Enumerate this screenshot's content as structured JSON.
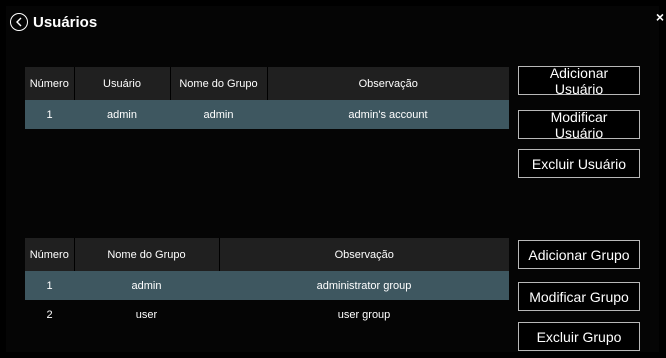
{
  "window": {
    "title": "Usuários"
  },
  "users_table": {
    "columns": [
      "Número",
      "Usuário",
      "Nome do Grupo",
      "Observação"
    ],
    "rows": [
      {
        "numero": "1",
        "usuario": "admin",
        "grupo": "admin",
        "observacao": "admin's account"
      }
    ]
  },
  "user_actions": {
    "add": "Adicionar Usuário",
    "modify": "Modificar Usuário",
    "delete": "Excluir Usuário"
  },
  "groups_table": {
    "columns": [
      "Número",
      "Nome do Grupo",
      "Observação"
    ],
    "rows": [
      {
        "numero": "1",
        "grupo": "admin",
        "observacao": "administrator group"
      },
      {
        "numero": "2",
        "grupo": "user",
        "observacao": "user group"
      }
    ]
  },
  "group_actions": {
    "add": "Adicionar Grupo",
    "modify": "Modificar Grupo",
    "delete": "Excluir Grupo"
  },
  "colors": {
    "background": "#000000",
    "header_cell": "#202020",
    "selected_row": "#3e5760",
    "button_border": "#b8b8b8"
  },
  "icons": {
    "back": "back-arrow-circle-icon",
    "close": "close-icon"
  }
}
